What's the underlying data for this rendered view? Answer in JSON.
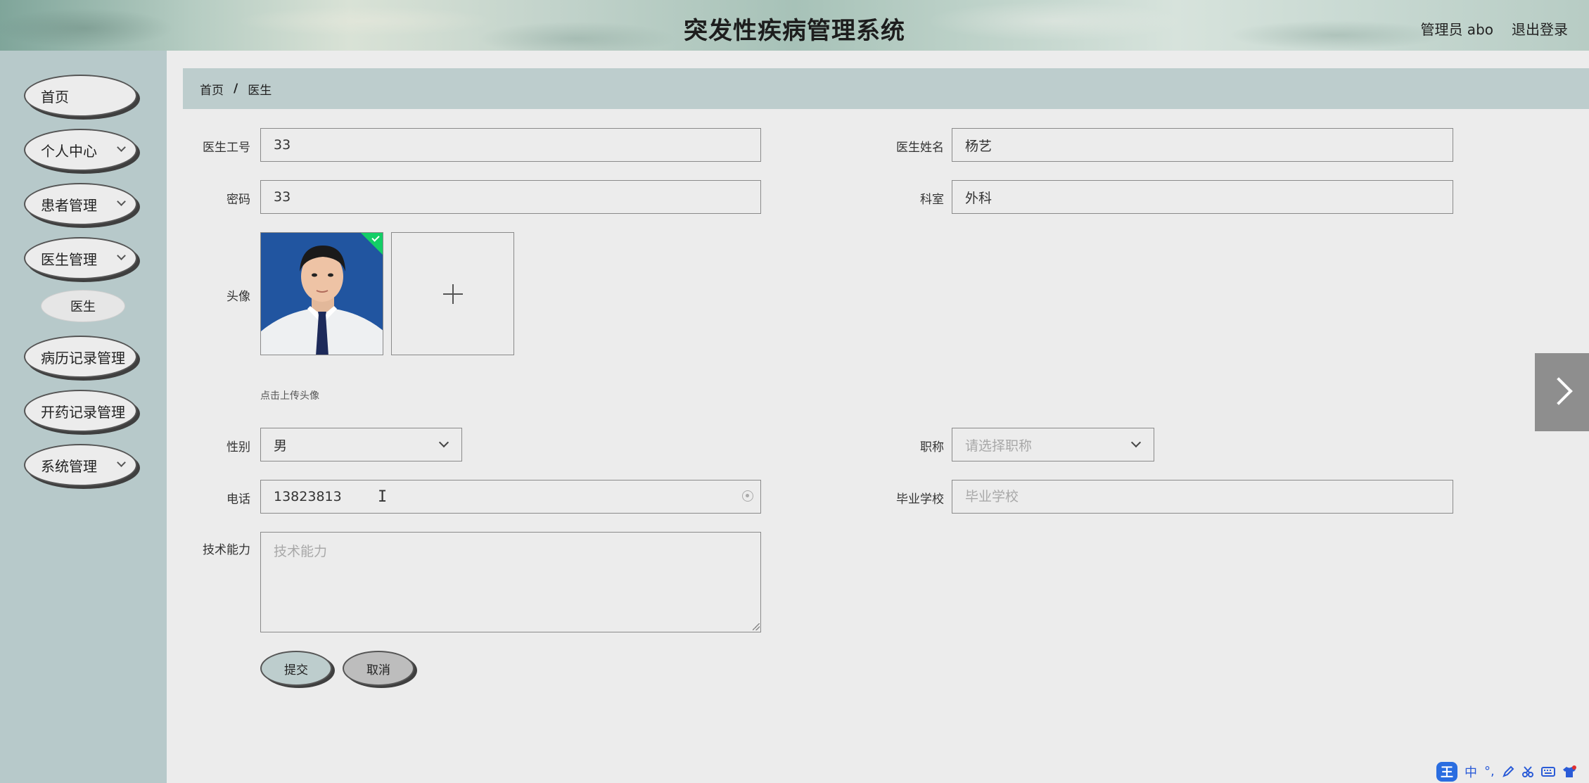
{
  "header": {
    "title": "突发性疾病管理系统",
    "user": "管理员 abo",
    "logout": "退出登录"
  },
  "sidebar": {
    "items": [
      {
        "label": "首页",
        "has_children": false
      },
      {
        "label": "个人中心",
        "has_children": true
      },
      {
        "label": "患者管理",
        "has_children": true
      },
      {
        "label": "医生管理",
        "has_children": true
      },
      {
        "label": "病历记录管理",
        "has_children": false
      },
      {
        "label": "开药记录管理",
        "has_children": false
      },
      {
        "label": "系统管理",
        "has_children": true
      }
    ],
    "submenu": {
      "label": "医生"
    }
  },
  "breadcrumb": {
    "home": "首页",
    "separator": "/",
    "current": "医生"
  },
  "form": {
    "doctor_id": {
      "label": "医生工号",
      "value": "33"
    },
    "doctor_name": {
      "label": "医生姓名",
      "value": "杨艺"
    },
    "password": {
      "label": "密码",
      "value": "33"
    },
    "department": {
      "label": "科室",
      "value": "外科"
    },
    "avatar": {
      "label": "头像",
      "hint": "点击上传头像"
    },
    "gender": {
      "label": "性别",
      "value": "男"
    },
    "title": {
      "label": "职称",
      "placeholder": "请选择职称"
    },
    "phone": {
      "label": "电话",
      "value": "13823813"
    },
    "school": {
      "label": "毕业学校",
      "placeholder": "毕业学校"
    },
    "skill": {
      "label": "技术能力",
      "placeholder": "技术能力"
    },
    "submit": "提交",
    "cancel": "取消"
  },
  "ime": {
    "logo": "王",
    "mode": "中",
    "punct": "°,"
  },
  "colors": {
    "sidebar_bg": "#b7c9ca",
    "breadcrumb_bg": "#bdcdcd",
    "page_bg": "#ececec",
    "success_badge": "#13ce66"
  }
}
